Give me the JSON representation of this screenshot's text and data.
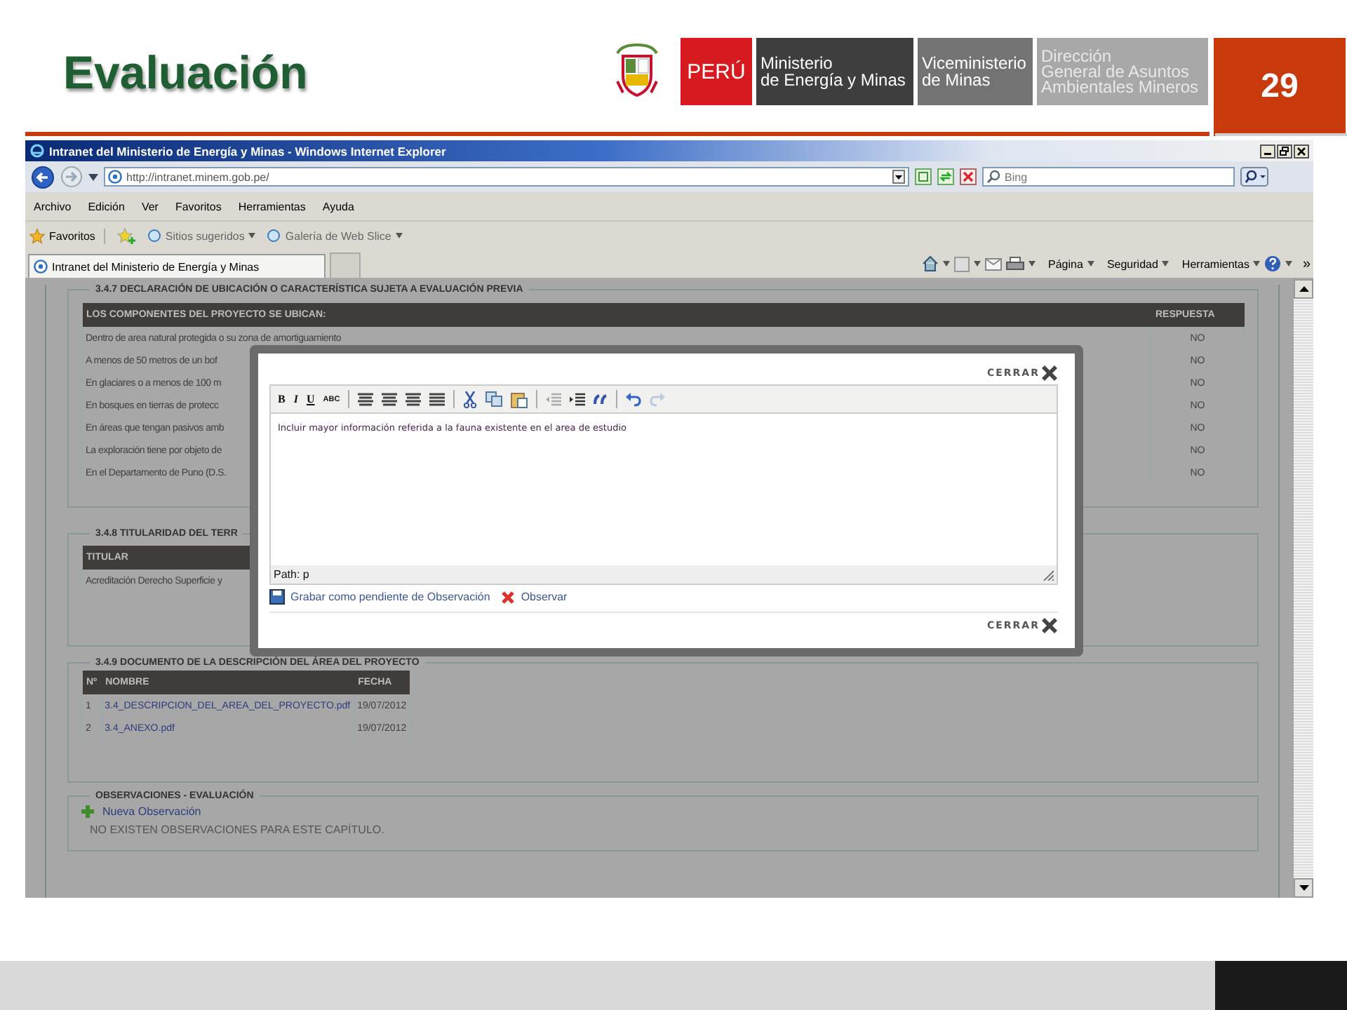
{
  "slide": {
    "title": "Evaluación",
    "page_number": "29"
  },
  "logos": {
    "country": "PERÚ",
    "blocks": [
      {
        "kind": "dark",
        "lines": [
          "Ministerio",
          "de Energía y Minas"
        ]
      },
      {
        "kind": "mid",
        "lines": [
          "Viceministerio",
          "de Minas"
        ]
      },
      {
        "kind": "light",
        "lines": [
          "Dirección",
          "General de Asuntos",
          "Ambientales Mineros"
        ]
      }
    ]
  },
  "browser": {
    "title": "Intranet del Ministerio de Energía y Minas - Windows Internet Explorer",
    "address": "http://intranet.minem.gob.pe/",
    "search_placeholder": "Bing",
    "menu": [
      "Archivo",
      "Edición",
      "Ver",
      "Favoritos",
      "Herramientas",
      "Ayuda"
    ],
    "favorites": "Favoritos",
    "links": [
      "Sitios sugeridos",
      "Galería de Web Slice"
    ],
    "tab": "Intranet del Ministerio de Energía y Minas",
    "commands": [
      "Página",
      "Seguridad",
      "Herramientas"
    ],
    "overflow": "»"
  },
  "declaration": {
    "title": "3.4.7 DECLARACIÓN DE UBICACIÓN O CARACTERÍSTICA SUJETA A EVALUACIÓN PREVIA",
    "columns": [
      "LOS COMPONENTES DEL PROYECTO SE UBICAN:",
      "RESPUESTA"
    ],
    "rows": [
      {
        "item": "Dentro de area natural protegida o su zona de amortiguamiento",
        "answer": "NO"
      },
      {
        "item": "A menos de 50 metros de un bof",
        "answer": "NO"
      },
      {
        "item": "En glaciares o a menos de 100 m",
        "answer": "NO"
      },
      {
        "item": "En bosques en tierras de protecc",
        "answer": "NO"
      },
      {
        "item": "En áreas que tengan pasivos amb",
        "answer": "NO"
      },
      {
        "item": "La exploración tiene por objeto de",
        "answer": "NO"
      },
      {
        "item": "En el Departamento de Puno (D.S.",
        "answer": "NO"
      }
    ]
  },
  "ownership": {
    "title": "3.4.8 TITULARIDAD DEL TERR",
    "column": "TITULAR",
    "rows": [
      "Acreditación Derecho Superficie y"
    ]
  },
  "documents": {
    "title": "3.4.9 DOCUMENTO DE LA DESCRIPCIÓN DEL ÁREA DEL PROYECTO",
    "columns": [
      "Nº",
      "NOMBRE",
      "FECHA"
    ],
    "rows": [
      {
        "number": "1",
        "name": "3.4_DESCRIPCION_DEL_AREA_DEL_PROYECTO.pdf",
        "date": "19/07/2012"
      },
      {
        "number": "2",
        "name": "3.4_ANEXO.pdf",
        "date": "19/07/2012"
      }
    ]
  },
  "observations": {
    "title": "OBSERVACIONES - EVALUACIÓN",
    "new_link": "Nueva Observación",
    "empty_message": "NO EXISTEN OBSERVACIONES PARA ESTE CAPÍTULO."
  },
  "dialog": {
    "close_top": "CERRAR",
    "close_bottom": "CERRAR",
    "format_buttons": [
      "B",
      "I",
      "U",
      "ABC"
    ],
    "content": "Incluir mayor información referida a la fauna existente en el area de estudio",
    "path": "Path: p",
    "save_link": "Grabar como pendiente de Observación",
    "observe_link": "Observar"
  }
}
